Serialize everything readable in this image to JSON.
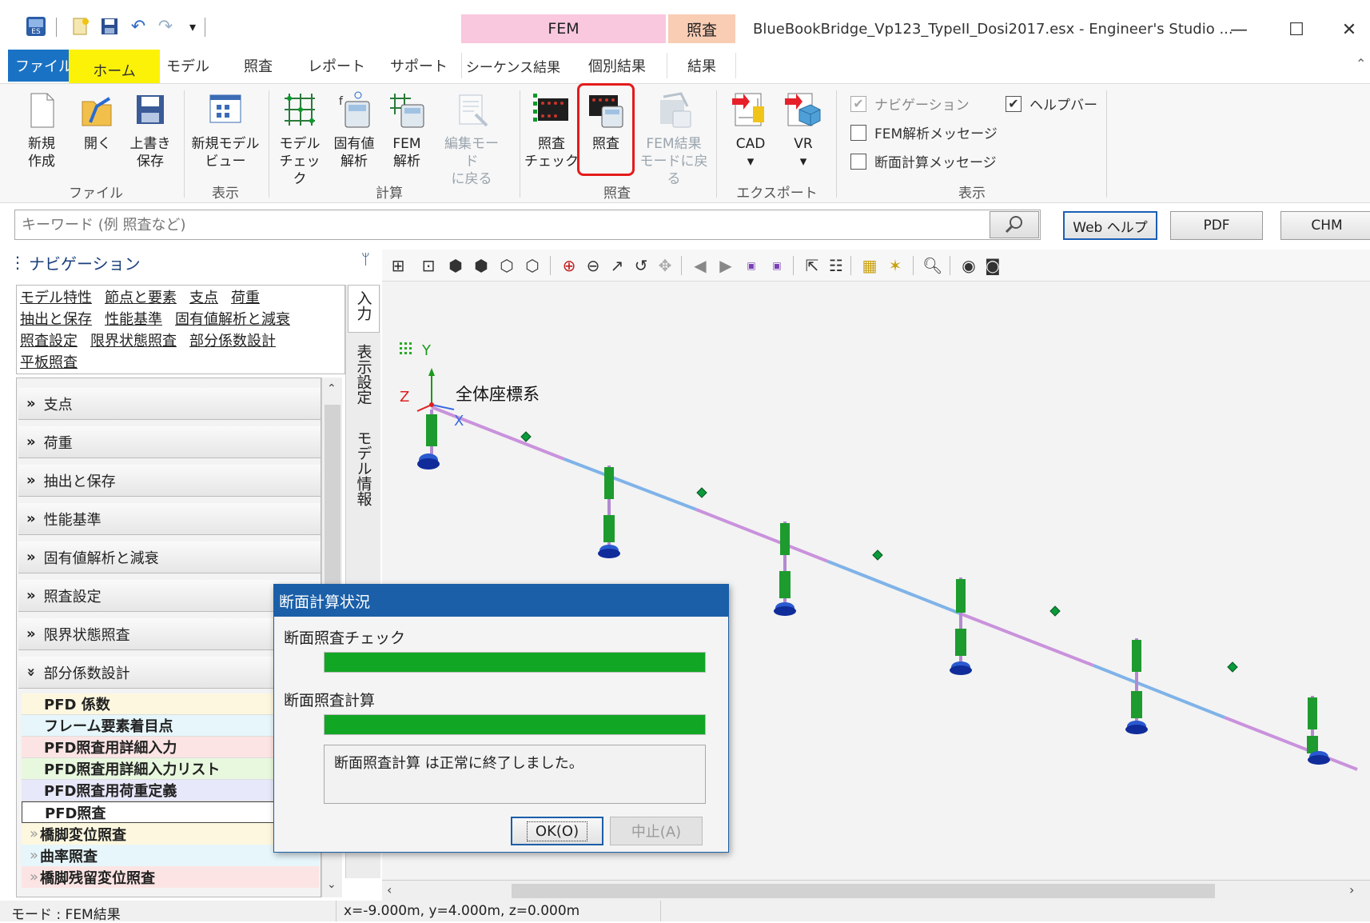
{
  "title": {
    "text": "BlueBookBridge_Vp123_TypeII_Dosi2017.esx - Engineer's Studio ...",
    "context_fem": "FEM",
    "context_shousa": "照査",
    "min_symbol": "—",
    "max_symbol": "☐",
    "close_symbol": "✕"
  },
  "tabs": {
    "file": "ファイル",
    "home": "ホーム",
    "model": "モデル",
    "check": "照査",
    "report": "レポート",
    "support": "サポート",
    "sequence_result": "シーケンス結果",
    "individual_result": "個別結果",
    "result": "結果"
  },
  "ribbon": {
    "new": [
      "新規",
      "作成"
    ],
    "open": [
      "開く",
      ""
    ],
    "save": [
      "上書き",
      "保存"
    ],
    "new_view": [
      "新規モデル",
      "ビュー"
    ],
    "model_check": [
      "モデル",
      "チェック"
    ],
    "eigen": [
      "固有値",
      "解析"
    ],
    "fem": [
      "FEM",
      "解析"
    ],
    "back_edit": [
      "編集モード",
      "に戻る"
    ],
    "shousa_check": [
      "照査",
      "チェック"
    ],
    "shousa": [
      "照査",
      ""
    ],
    "back_fem": [
      "FEM結果",
      "モードに戻る"
    ],
    "cad": [
      "CAD",
      "▾"
    ],
    "vr": [
      "VR",
      "▾"
    ],
    "groups": {
      "file": "ファイル",
      "display": "表示",
      "calc": "計算",
      "shousa": "照査",
      "export": "エクスポート",
      "display2": "表示"
    },
    "checks": {
      "navigation": "ナビゲーション",
      "helpbar": "ヘルプバー",
      "fem_msg": "FEM解析メッセージ",
      "section_msg": "断面計算メッセージ"
    }
  },
  "search": {
    "placeholder": "キーワード (例 照査など)",
    "web_help": "Web ヘルプ",
    "pdf": "PDF",
    "chm": "CHM"
  },
  "nav": {
    "header": "ナビゲーション",
    "pin": "ᛘ",
    "links_row1": [
      "モデル特性",
      "節点と要素",
      "支点",
      "荷重"
    ],
    "links_row2": [
      "抽出と保存",
      "性能基準",
      "固有値解析と減衰"
    ],
    "links_row3": [
      "照査設定",
      "限界状態照査",
      "部分係数設計"
    ],
    "links_row4": [
      "平板照査"
    ],
    "accordion": [
      "支点",
      "荷重",
      "抽出と保存",
      "性能基準",
      "固有値解析と減衰",
      "照査設定",
      "限界状態照査",
      "部分係数設計"
    ],
    "collapsed_chevron": "»",
    "expanded_chevron": "»",
    "sub_items": [
      "PFD 係数",
      "フレーム要素着目点",
      "PFD照査用詳細入力",
      "PFD照査用詳細入力リスト",
      "PFD照査用荷重定義",
      "PFD照査"
    ],
    "sub2_items": [
      "橋脚変位照査",
      "曲率照査",
      "橋脚残留変位照査"
    ],
    "vtabs": [
      "入力",
      "表示設定",
      "モデル情報"
    ]
  },
  "viewport": {
    "axis_y": "Y",
    "axis_z": "Z",
    "axis_x": "X",
    "coord_label": "全体座標系"
  },
  "dialog": {
    "title": "断面計算状況",
    "label1": "断面照査チェック",
    "label2": "断面照査計算",
    "progress1": 1.0,
    "progress2": 1.0,
    "message": "断面照査計算 は正常に終了しました。",
    "ok": "OK(O)",
    "cancel": "中止(A)"
  },
  "status": {
    "mode": "モード : FEM結果",
    "coords": "x=-9.000m, y=4.000m, z=0.000m"
  },
  "colors": {
    "file_tab": "#1a72c4",
    "home_highlight": "#fbf208",
    "progress": "#11a624",
    "dialog_title": "#1a5fa8",
    "highlight_box": "#e41b1b"
  }
}
